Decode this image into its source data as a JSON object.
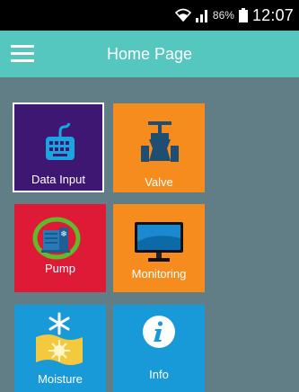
{
  "status_bar": {
    "battery": "86%",
    "time": "12:07"
  },
  "app_bar": {
    "title": "Home Page"
  },
  "tiles": [
    {
      "label": "Data Input",
      "icon": "keyboard-icon",
      "color": "#3d1772"
    },
    {
      "label": "Valve",
      "icon": "valve-icon",
      "color": "#f58c1d"
    },
    {
      "label": "Pump",
      "icon": "pump-icon",
      "color": "#de1a37"
    },
    {
      "label": "Monitoring",
      "icon": "monitor-icon",
      "color": "#f58c1d"
    },
    {
      "label": "Moisture",
      "icon": "snowflake-sun-icon",
      "color": "#1899d8"
    },
    {
      "label": "Info",
      "icon": "info-icon",
      "color": "#1899d8"
    }
  ],
  "colors": {
    "app_bar": "#56c7bf",
    "background": "#617e86",
    "status_bar": "#000000"
  }
}
